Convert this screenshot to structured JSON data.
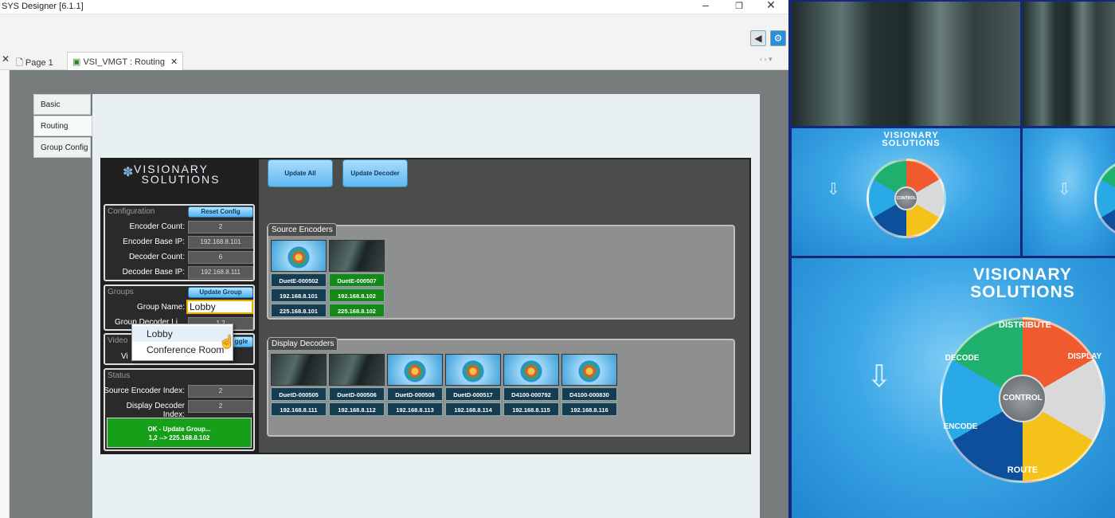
{
  "app": {
    "title": "SYS Designer [6.1.1]"
  },
  "tabs": [
    {
      "label": "Page 1"
    },
    {
      "label": "VSI_VMGT : Routing"
    }
  ],
  "side_tabs": [
    "Basic",
    "Routing",
    "Group Config"
  ],
  "logo": {
    "line1": "VISIONARY",
    "line2": "SOLUTIONS"
  },
  "buttons": {
    "update_all": "Update All",
    "update_decoder": "Update Decoder",
    "reset_config": "Reset Config",
    "update_group": "Update Group",
    "toggle": "ggle"
  },
  "configuration": {
    "heading": "Configuration",
    "fields": [
      {
        "label": "Encoder Count:",
        "value": "2"
      },
      {
        "label": "Encoder Base IP:",
        "value": "192.168.8.101"
      },
      {
        "label": "Decoder Count:",
        "value": "6"
      },
      {
        "label": "Decoder Base IP:",
        "value": "192.168.8.111"
      }
    ]
  },
  "groups": {
    "heading": "Groups",
    "name_label": "Group Name:",
    "name_value": "Lobby",
    "decoder_label": "Group Decoder Li",
    "decoder_value": "1,2",
    "dropdown_options": [
      "Lobby",
      "Conference Room"
    ]
  },
  "video": {
    "heading": "Video",
    "label": "Vi"
  },
  "status": {
    "heading": "Status",
    "fields": [
      {
        "label": "Source Encoder Index:",
        "value": "2"
      },
      {
        "label": "Display Decoder Index:",
        "value": "2"
      }
    ],
    "message_line1": "OK - Update Group...",
    "message_line2": "1,2 --> 225.168.8.102"
  },
  "source_encoders": {
    "heading": "Source Encoders",
    "items": [
      {
        "name": "DuetE-000502",
        "ip": "192.168.8.101",
        "multicast": "225.168.8.101",
        "thumb": "blue",
        "color": "dark"
      },
      {
        "name": "DuetE-000507",
        "ip": "192.168.8.102",
        "multicast": "225.168.8.102",
        "thumb": "movie",
        "color": "green"
      }
    ]
  },
  "display_decoders": {
    "heading": "Display Decoders",
    "items": [
      {
        "name": "DuetD-000505",
        "ip": "192.168.8.111",
        "thumb": "movie"
      },
      {
        "name": "DuetD-000506",
        "ip": "192.168.8.112",
        "thumb": "movie"
      },
      {
        "name": "DuetD-000508",
        "ip": "192.168.8.113",
        "thumb": "blue"
      },
      {
        "name": "DuetD-000517",
        "ip": "192.168.8.114",
        "thumb": "blue"
      },
      {
        "name": "D4100-000792",
        "ip": "192.168.8.115",
        "thumb": "blue"
      },
      {
        "name": "D4100-000830",
        "ip": "192.168.8.116",
        "thumb": "blue"
      }
    ]
  },
  "video_wall": {
    "logo_line1": "VISIONARY",
    "logo_line2": "SOLUTIONS",
    "wheel_labels": [
      "DISTRIBUTE",
      "DISPLAY",
      "ROUTE",
      "ENCODE",
      "DECODE"
    ],
    "hub_label": "CONTROL"
  }
}
